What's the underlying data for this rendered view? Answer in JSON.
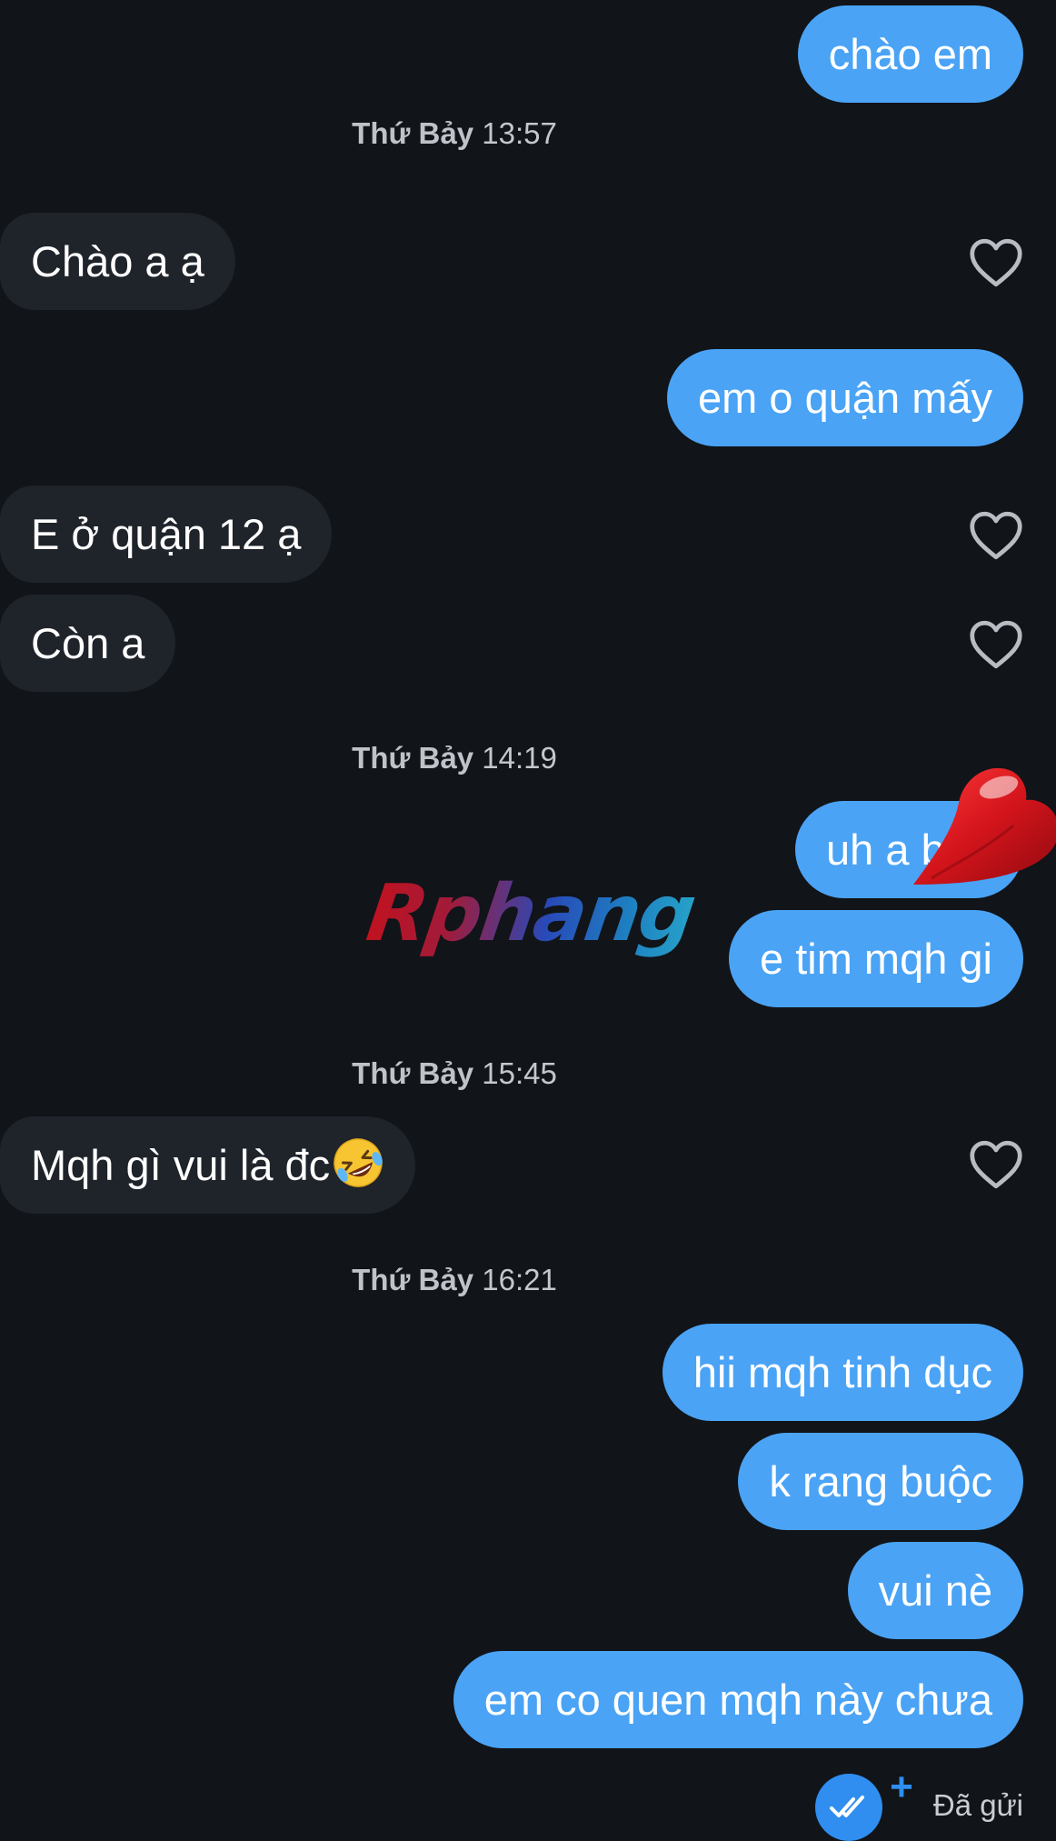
{
  "messages": [
    {
      "side": "out",
      "text": "chào em"
    },
    {
      "timestamp_day": "Thứ Bảy",
      "timestamp_time": "13:57"
    },
    {
      "side": "in",
      "text": "Chào a ạ"
    },
    {
      "side": "out",
      "text": "em o quận mấy"
    },
    {
      "side": "in",
      "text": "E ở quận 12 ạ"
    },
    {
      "side": "in",
      "text": "Còn a"
    },
    {
      "timestamp_day": "Thứ Bảy",
      "timestamp_time": "14:19"
    },
    {
      "side": "out",
      "text": "uh a bên"
    },
    {
      "side": "out",
      "text": "e tim mqh gi"
    },
    {
      "timestamp_day": "Thứ Bảy",
      "timestamp_time": "15:45"
    },
    {
      "side": "in",
      "text": "Mqh gì vui là đc"
    },
    {
      "timestamp_day": "Thứ Bảy",
      "timestamp_time": "16:21"
    },
    {
      "side": "out",
      "text": "hii mqh tinh dục"
    },
    {
      "side": "out",
      "text": "k rang buộc"
    },
    {
      "side": "out",
      "text": "vui nè"
    },
    {
      "side": "out",
      "text": "em co quen mqh này chưa"
    }
  ],
  "watermark": "Rphang",
  "status": {
    "sent_label": "Đã gửi",
    "plus": "+"
  },
  "icons": {
    "like": "heart-outline-icon",
    "reaction": "red-heart-icon",
    "emoji": "rolling-on-floor-laughing-emoji",
    "read": "double-check-icon"
  },
  "colors": {
    "background": "#111419",
    "outgoing_bubble": "#4aa3f5",
    "incoming_bubble": "#1f232a",
    "accent": "#2f8ef0"
  }
}
